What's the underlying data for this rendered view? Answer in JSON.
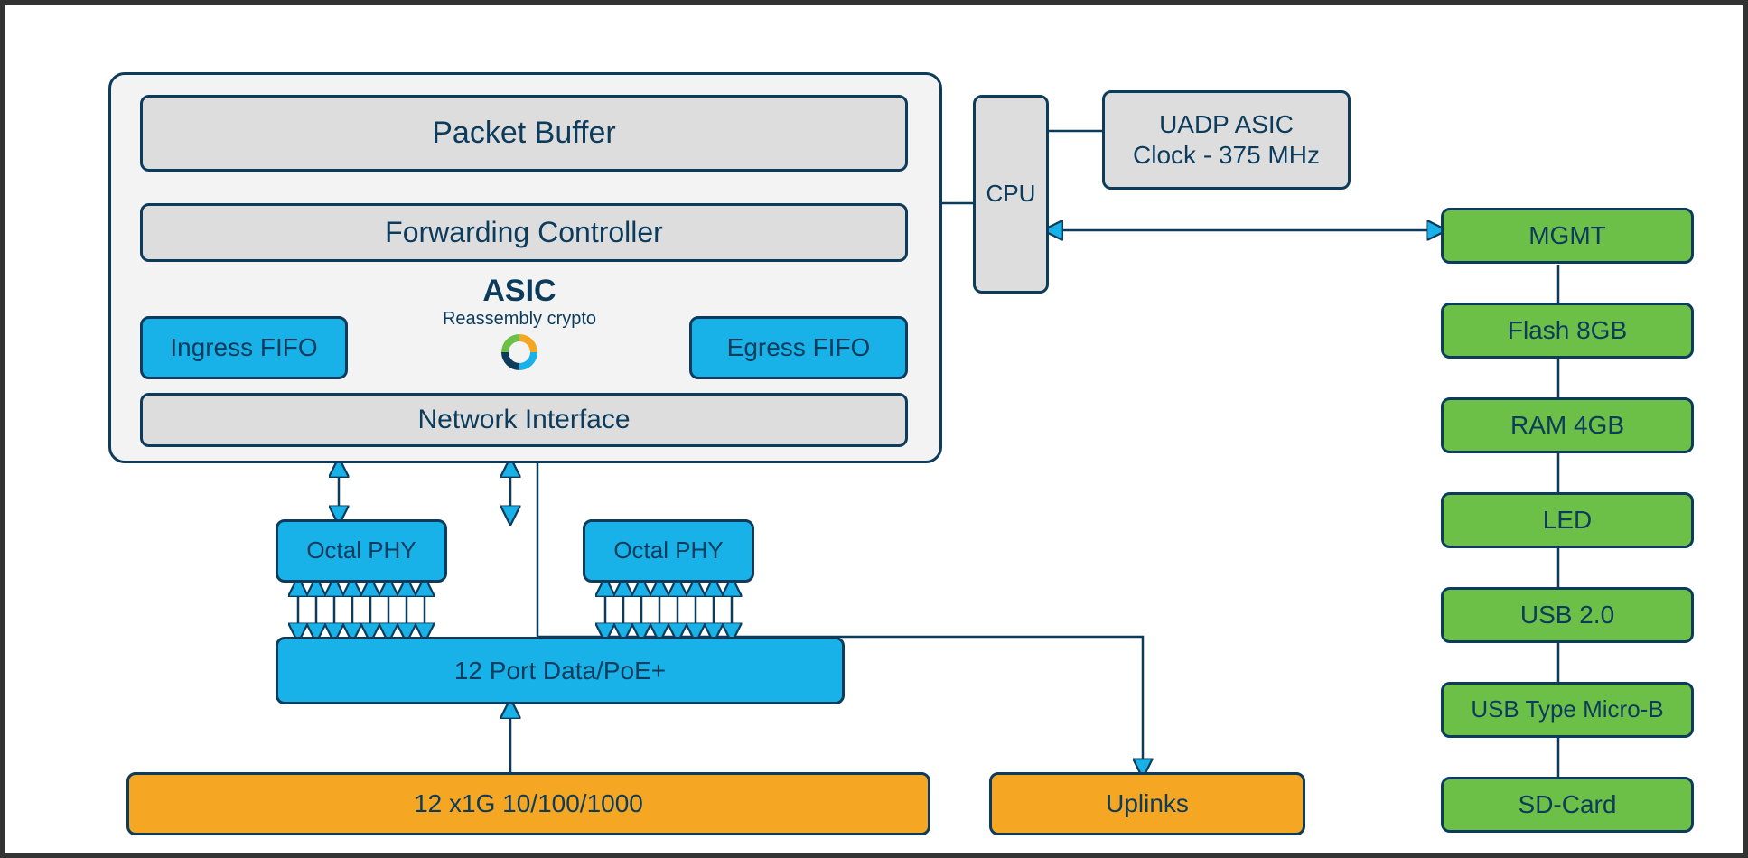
{
  "asic_block": {
    "packet_buffer": "Packet Buffer",
    "forwarding_controller": "Forwarding Controller",
    "ingress_fifo": "Ingress FIFO",
    "egress_fifo": "Egress FIFO",
    "network_interface": "Network Interface",
    "asic_title": "ASIC",
    "asic_subtitle": "Reassembly crypto"
  },
  "cpu": "CPU",
  "uadp": "UADP ASIC\nClock - 375 MHz",
  "phy1": "Octal PHY",
  "phy2": "Octal PHY",
  "port_data": "12 Port Data/PoE+",
  "gig_ports": "12 x1G 10/100/1000",
  "uplinks": "Uplinks",
  "right_stack": {
    "mgmt": "MGMT",
    "flash": "Flash 8GB",
    "ram": "RAM 4GB",
    "led": "LED",
    "usb20": "USB 2.0",
    "usb_micro": "USB Type Micro-B",
    "sdcard": "SD-Card"
  },
  "colors": {
    "stroke": "#0d3b5c",
    "arrow_fill": "#18b2e8"
  }
}
